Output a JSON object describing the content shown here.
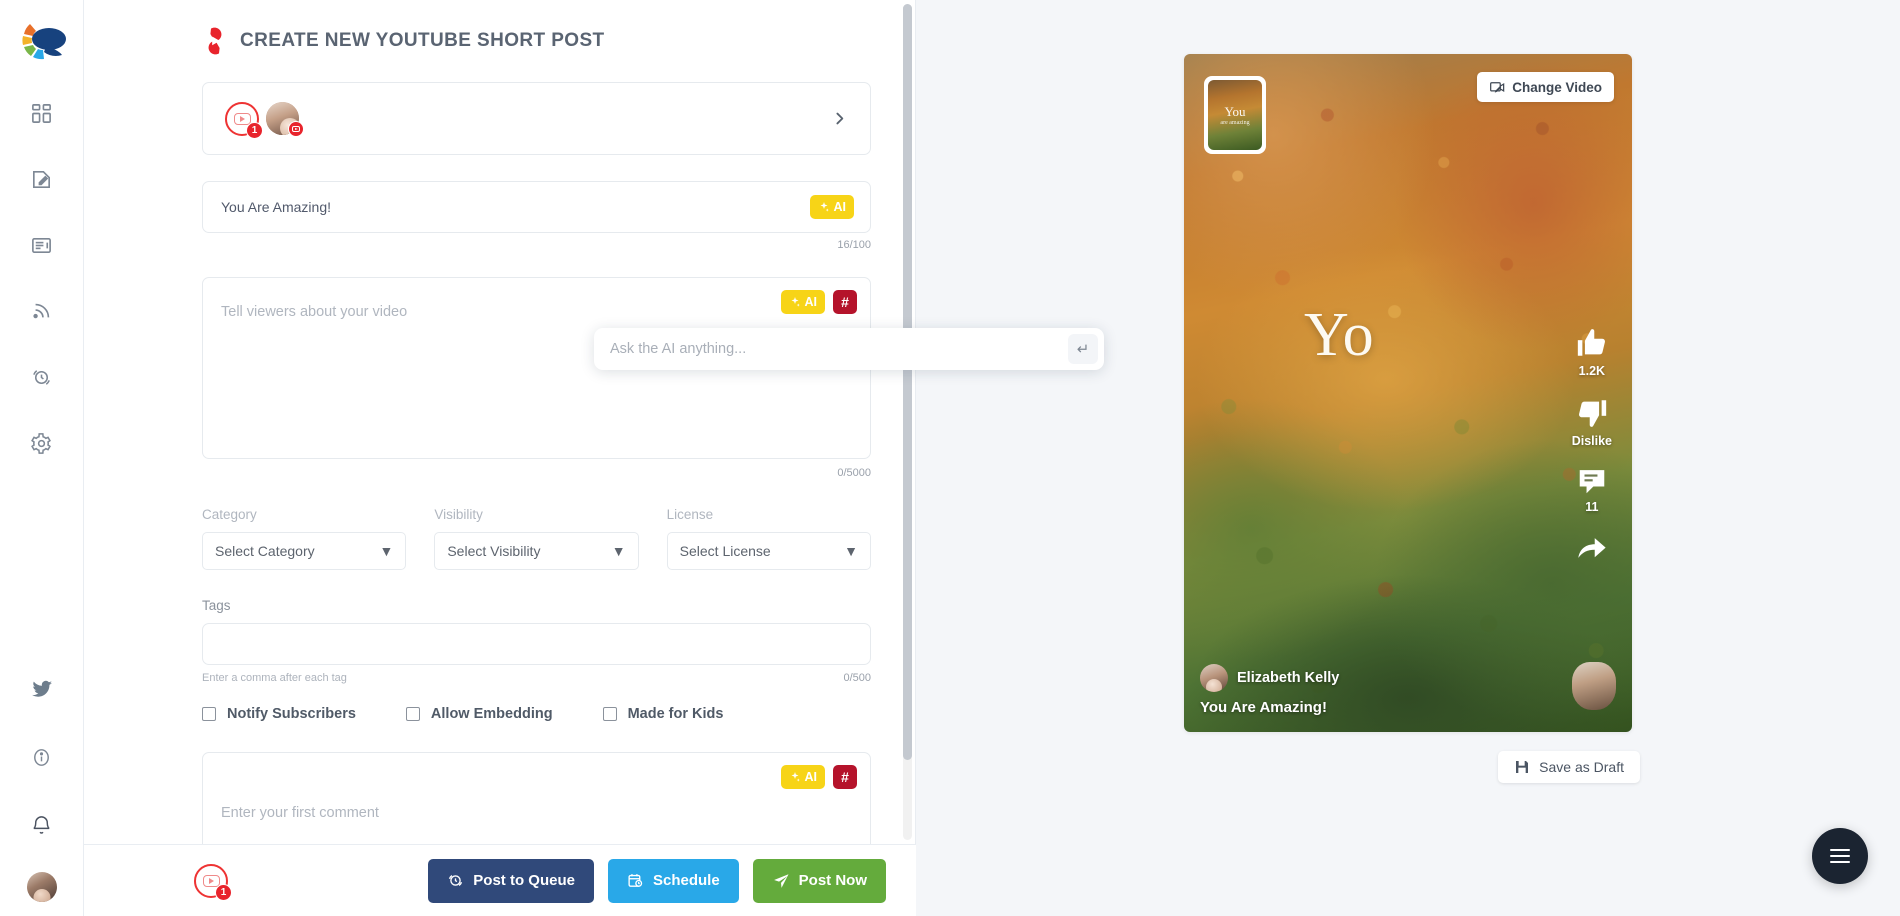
{
  "sidebar": {
    "logo_name": "app-logo",
    "items": [
      {
        "name": "dashboard",
        "icon": "grid-icon"
      },
      {
        "name": "compose",
        "icon": "pencil-square-icon"
      },
      {
        "name": "content",
        "icon": "newspaper-icon"
      },
      {
        "name": "feeds",
        "icon": "rss-icon"
      },
      {
        "name": "queue",
        "icon": "clock-refresh-icon"
      },
      {
        "name": "settings",
        "icon": "gear-icon"
      }
    ],
    "bottom_items": [
      {
        "name": "twitter",
        "icon": "twitter-bird-icon"
      },
      {
        "name": "info",
        "icon": "info-circle-icon"
      },
      {
        "name": "notifications",
        "icon": "bell-icon"
      },
      {
        "name": "profile",
        "icon": "user-avatar"
      }
    ]
  },
  "header": {
    "title": "CREATE NEW YOUTUBE SHORT POST",
    "platform_icon": "youtube-shorts-icon"
  },
  "account_selector": {
    "badge_count": "1",
    "chevron": "chevron-right-icon"
  },
  "title_field": {
    "value": "You Are Amazing!",
    "counter": "16/100",
    "ai_label": "AI",
    "hash_label": "#"
  },
  "description_field": {
    "placeholder": "Tell viewers about your video",
    "counter": "0/5000",
    "ai_label": "AI",
    "hash_label": "#"
  },
  "ai_prompt": {
    "placeholder": "Ask the AI anything...",
    "value": "",
    "submit_icon": "enter-arrow-icon"
  },
  "selects": [
    {
      "label": "Category",
      "value": "Select Category"
    },
    {
      "label": "Visibility",
      "value": "Select Visibility"
    },
    {
      "label": "License",
      "value": "Select License"
    }
  ],
  "tags": {
    "label": "Tags",
    "value": "",
    "hint": "Enter a comma after each tag",
    "counter": "0/500"
  },
  "checkboxes": [
    {
      "label": "Notify Subscribers",
      "checked": false
    },
    {
      "label": "Allow Embedding",
      "checked": false
    },
    {
      "label": "Made for Kids",
      "checked": false
    }
  ],
  "first_comment": {
    "placeholder": "Enter your first comment",
    "ai_label": "AI",
    "hash_label": "#"
  },
  "bottom_bar": {
    "badge_count": "1",
    "post_queue_label": "Post to Queue",
    "schedule_label": "Schedule",
    "post_now_label": "Post Now"
  },
  "preview": {
    "change_video_label": "Change Video",
    "overlay_text": "Yo",
    "thumbnail_line1": "You",
    "thumbnail_line2": "are amazing",
    "actions": [
      {
        "name": "like",
        "icon": "thumbs-up-icon",
        "label": "1.2K"
      },
      {
        "name": "dislike",
        "icon": "thumbs-down-icon",
        "label": "Dislike"
      },
      {
        "name": "comment",
        "icon": "comment-icon",
        "label": "11"
      },
      {
        "name": "share",
        "icon": "share-arrow-icon",
        "label": ""
      }
    ],
    "user_name": "Elizabeth Kelly",
    "caption": "You Are Amazing!",
    "save_draft_label": "Save as Draft"
  },
  "fab": {
    "icon": "hamburger-menu-icon"
  },
  "colors": {
    "ai_yellow": "#f7d417",
    "hash_red": "#b5132b",
    "youtube_red": "#e8242c",
    "queue_navy": "#30497a",
    "schedule_blue": "#29a8e8",
    "post_green": "#64ab3c",
    "fab_dark": "#1b2431"
  }
}
